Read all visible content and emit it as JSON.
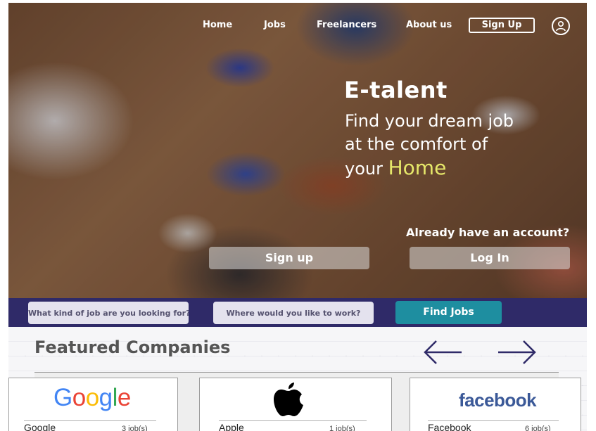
{
  "colors": {
    "accent_yellow": "#e6e86a",
    "search_bar_bg": "#2f2a68",
    "find_button": "#1e8ea0",
    "facebook_blue": "#3b5998"
  },
  "nav": {
    "links": [
      "Home",
      "Jobs",
      "Freelancers",
      "About us"
    ],
    "signup": "Sign Up",
    "user_icon": "user-circle-icon"
  },
  "hero": {
    "brand": "E-talent",
    "tagline_line1": "Find your dream job",
    "tagline_line2": "at the comfort of",
    "tagline_line3_prefix": "your",
    "tagline_highlight": "Home",
    "already_text": "Already have an account?",
    "signup_button": "Sign up",
    "login_button": "Log In"
  },
  "search": {
    "job_placeholder": "What kind of job are you looking for?",
    "location_placeholder": "Where would you like to work?",
    "find_button": "Find Jobs"
  },
  "featured": {
    "title": "Featured Companies",
    "prev_icon": "arrow-left-icon",
    "next_icon": "arrow-right-icon",
    "companies": [
      {
        "name": "Google",
        "count": "3 job(s)",
        "logo": "Google"
      },
      {
        "name": "Apple",
        "count": "1 job(s)",
        "logo": "apple-logo-icon"
      },
      {
        "name": "Facebook",
        "count": "6 job(s)",
        "logo": "facebook"
      }
    ]
  }
}
